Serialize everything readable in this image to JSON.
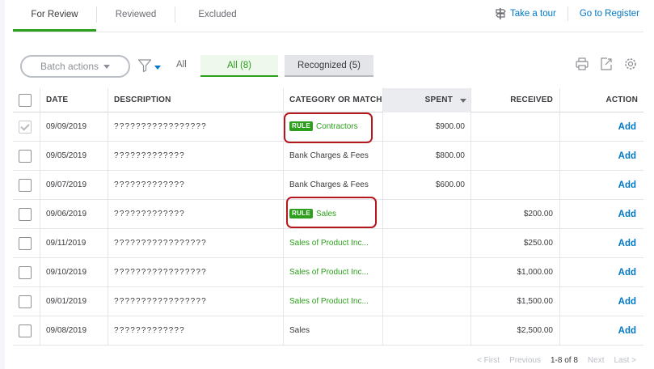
{
  "tabs": [
    {
      "label": "For Review",
      "active": true
    },
    {
      "label": "Reviewed",
      "active": false
    },
    {
      "label": "Excluded",
      "active": false
    }
  ],
  "links": {
    "tour": "Take a tour",
    "register": "Go to Register"
  },
  "toolbar": {
    "batch_actions": "Batch actions",
    "filter_all": "All",
    "seg_all": "All (8)",
    "seg_recognized": "Recognized (5)"
  },
  "table": {
    "columns": {
      "date": "DATE",
      "description": "DESCRIPTION",
      "category": "CATEGORY OR MATCH",
      "spent": "SPENT",
      "received": "RECEIVED",
      "action": "ACTION"
    },
    "rule_badge": "RULE",
    "rows": [
      {
        "date": "09/09/2019",
        "description": "?????????????????",
        "category": "Contractors",
        "rule": true,
        "green": true,
        "spent": "$900.00",
        "received": "",
        "action": "Add",
        "checked": true
      },
      {
        "date": "09/05/2019",
        "description": "?????????????",
        "category": "Bank Charges & Fees",
        "rule": false,
        "green": false,
        "spent": "$800.00",
        "received": "",
        "action": "Add",
        "checked": false
      },
      {
        "date": "09/07/2019",
        "description": "?????????????",
        "category": "Bank Charges & Fees",
        "rule": false,
        "green": false,
        "spent": "$600.00",
        "received": "",
        "action": "Add",
        "checked": false
      },
      {
        "date": "09/06/2019",
        "description": "?????????????",
        "category": "Sales",
        "rule": true,
        "green": true,
        "spent": "",
        "received": "$200.00",
        "action": "Add",
        "checked": false
      },
      {
        "date": "09/11/2019",
        "description": "?????????????????",
        "category": "Sales of Product Inc...",
        "rule": false,
        "green": true,
        "spent": "",
        "received": "$250.00",
        "action": "Add",
        "checked": false
      },
      {
        "date": "09/10/2019",
        "description": "?????????????????",
        "category": "Sales of Product Inc...",
        "rule": false,
        "green": true,
        "spent": "",
        "received": "$1,000.00",
        "action": "Add",
        "checked": false
      },
      {
        "date": "09/01/2019",
        "description": "?????????????????",
        "category": "Sales of Product Inc...",
        "rule": false,
        "green": true,
        "spent": "",
        "received": "$1,500.00",
        "action": "Add",
        "checked": false
      },
      {
        "date": "09/08/2019",
        "description": "?????????????",
        "category": "Sales",
        "rule": false,
        "green": false,
        "spent": "",
        "received": "$2,500.00",
        "action": "Add",
        "checked": false
      }
    ]
  },
  "pagination": {
    "first": "< First",
    "previous": "Previous",
    "range": "1-8 of 8",
    "next": "Next",
    "last": "Last >"
  },
  "colors": {
    "brand_green": "#2ca01c",
    "link_blue": "#0077c5",
    "highlight_red": "#b4181c"
  }
}
